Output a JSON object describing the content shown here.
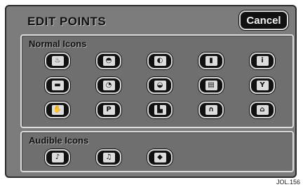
{
  "header": {
    "title": "EDIT POINTS",
    "cancel_label": "Cancel"
  },
  "normal": {
    "label": "Normal Icons",
    "icons": [
      {
        "name": "camera-icon",
        "glyph": "♨"
      },
      {
        "name": "shell-icon",
        "glyph": "◓"
      },
      {
        "name": "leaf-icon",
        "glyph": "◐"
      },
      {
        "name": "fuel-pump-icon",
        "glyph": "▮"
      },
      {
        "name": "info-icon",
        "glyph": "i"
      },
      {
        "name": "card-icon",
        "glyph": "▬"
      },
      {
        "name": "fish-icon",
        "glyph": "◔"
      },
      {
        "name": "dome-icon",
        "glyph": "◒"
      },
      {
        "name": "picture-icon",
        "glyph": "▤"
      },
      {
        "name": "glass-icon",
        "glyph": "Y"
      },
      {
        "name": "hand-icon",
        "glyph": "✋"
      },
      {
        "name": "parking-icon",
        "glyph": "P"
      },
      {
        "name": "building-icon",
        "glyph": "▙"
      },
      {
        "name": "gate-icon",
        "glyph": "∩"
      },
      {
        "name": "house-icon",
        "glyph": "⌂"
      }
    ]
  },
  "audible": {
    "label": "Audible Icons",
    "icons": [
      {
        "name": "music-note-icon",
        "glyph": "♪"
      },
      {
        "name": "music-notes-icon",
        "glyph": "♫"
      },
      {
        "name": "diamond-icon",
        "glyph": "◆"
      }
    ]
  },
  "figure_ref": "JOL.156"
}
